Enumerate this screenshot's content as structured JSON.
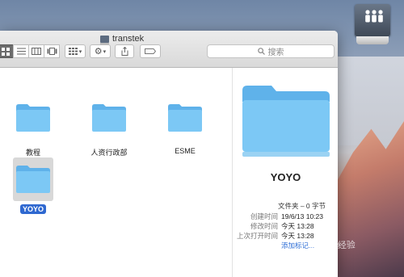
{
  "window": {
    "title": "transtek",
    "search_placeholder": "搜索"
  },
  "folders": [
    {
      "name": "教程"
    },
    {
      "name": "人资行政部"
    },
    {
      "name": "ESME"
    },
    {
      "name": "YOYO",
      "selected": true
    }
  ],
  "preview": {
    "name": "YOYO",
    "kind_size": "文件夹 – 0 字节",
    "created_label": "创建时间",
    "created_value": "19/6/13 10:23",
    "modified_label": "修改时间",
    "modified_value": "今天 13:28",
    "opened_label": "上次打开时间",
    "opened_value": "今天 13:28",
    "add_tags": "添加标记..."
  },
  "watermark": "Baidu 经验",
  "colors": {
    "folder": "#7cc8f5",
    "selection": "#2f68d0",
    "link": "#2f6fd6"
  },
  "icons": [
    "network-drive-icon",
    "folder-icon",
    "gear-icon",
    "share-icon",
    "tag-icon",
    "search-icon",
    "icon-view-icon",
    "list-view-icon",
    "column-view-icon",
    "coverflow-view-icon",
    "group-icon"
  ]
}
